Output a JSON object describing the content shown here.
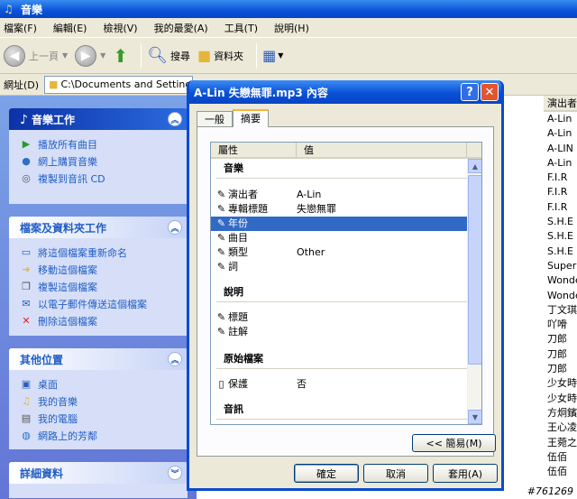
{
  "window": {
    "title": "音樂"
  },
  "menu": [
    "檔案(F)",
    "編輯(E)",
    "檢視(V)",
    "我的最愛(A)",
    "工具(T)",
    "說明(H)"
  ],
  "toolbar": {
    "back": "上一頁",
    "search": "搜尋",
    "folders": "資料夾"
  },
  "address": {
    "label": "網址(D)",
    "value": "C:\\Documents and Settings\\Use"
  },
  "left_panels": [
    {
      "title": "音樂工作",
      "items": [
        "播放所有曲目",
        "網上購買音樂",
        "複製到音訊 CD"
      ]
    },
    {
      "title": "檔案及資料夾工作",
      "items": [
        "將這個檔案重新命名",
        "移動這個檔案",
        "複製這個檔案",
        "以電子郵件傳送這個檔案",
        "刪除這個檔案"
      ]
    },
    {
      "title": "其他位置",
      "items": [
        "桌面",
        "我的音樂",
        "我的電腦",
        "網路上的芳鄰"
      ]
    },
    {
      "title": "詳細資料",
      "items": []
    }
  ],
  "right_column": {
    "header": "演出者",
    "values": [
      "A-Lin",
      "A-Lin",
      "A-LIN",
      "A-Lin",
      "F.I.R",
      "F.I.R",
      "F.I.R",
      "S.H.E",
      "S.H.E",
      "S.H.E",
      "Super J",
      "Wonde",
      "Wonde",
      "丁文琪",
      "吖嗗",
      "刀郎",
      "刀郎",
      "刀郎",
      "少女時",
      "少女時",
      "方炯鑌",
      "王心凌",
      "王菀之",
      "伍佰",
      "伍佰"
    ]
  },
  "dialog": {
    "title": "A-Lin 失戀無罪.mp3 內容",
    "tabs": [
      "一般",
      "摘要"
    ],
    "list_headers": [
      "屬性",
      "值"
    ],
    "groups": {
      "music": "音樂",
      "description": "說明",
      "origin": "原始檔案",
      "audio": "音訊"
    },
    "rows": {
      "artist": {
        "key": "演出者",
        "value": "A-Lin"
      },
      "album": {
        "key": "專輯標題",
        "value": "失戀無罪"
      },
      "year": {
        "key": "年份",
        "value": ""
      },
      "track": {
        "key": "曲目",
        "value": ""
      },
      "genre": {
        "key": "類型",
        "value": "Other"
      },
      "lyrics": {
        "key": "詞",
        "value": ""
      },
      "title": {
        "key": "標題",
        "value": ""
      },
      "comment": {
        "key": "註解",
        "value": ""
      },
      "protected": {
        "key": "保護",
        "value": "否"
      }
    },
    "simple_button": "<< 簡易(M)",
    "ok": "確定",
    "cancel": "取消",
    "apply": "套用(A)"
  },
  "watermark": "#761269"
}
